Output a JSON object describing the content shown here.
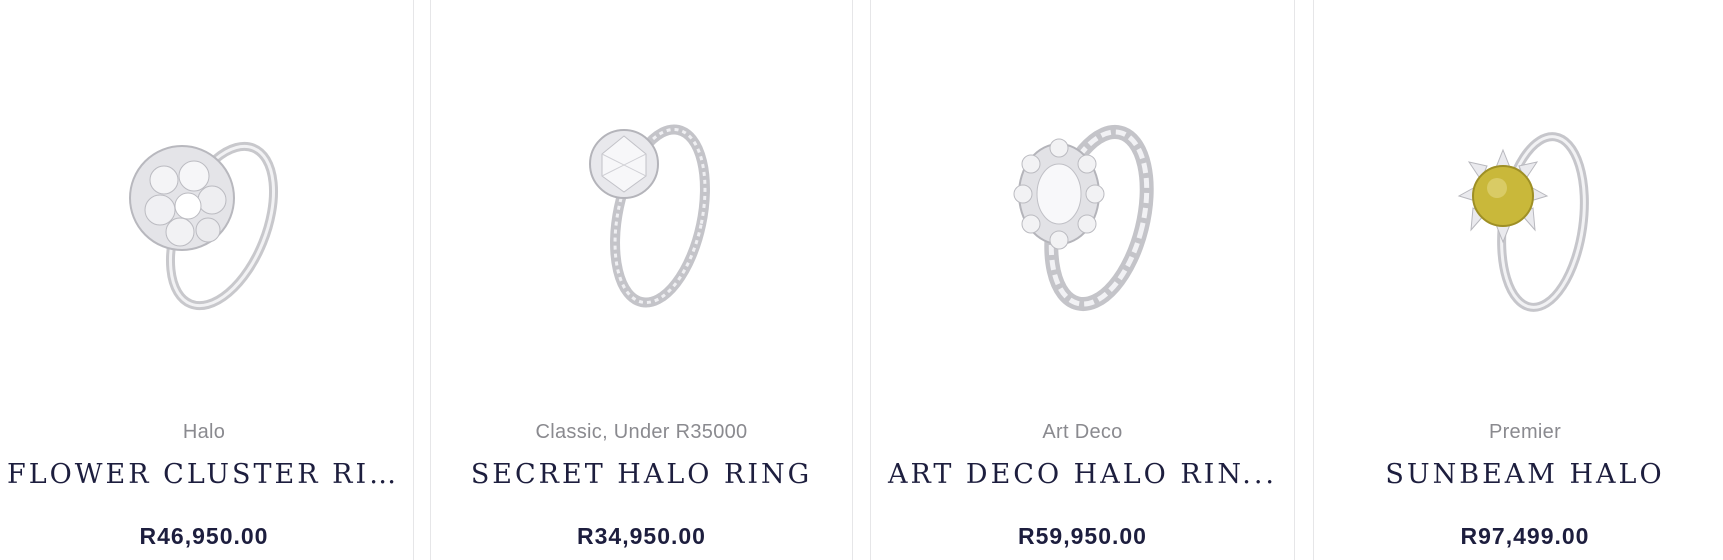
{
  "products": [
    {
      "category": "Halo",
      "title": "FLOWER CLUSTER RI...",
      "price": "R46,950.00",
      "image_icon": "ring-icon"
    },
    {
      "category": "Classic, Under R35000",
      "title": "SECRET HALO RING",
      "price": "R34,950.00",
      "image_icon": "ring-icon"
    },
    {
      "category": "Art Deco",
      "title": "ART DECO HALO RIN...",
      "price": "R59,950.00",
      "image_icon": "ring-icon"
    },
    {
      "category": "Premier",
      "title": "SUNBEAM HALO",
      "price": "R97,499.00",
      "image_icon": "ring-icon"
    }
  ],
  "colors": {
    "title": "#1d1e3e",
    "category": "#8a8a8f",
    "card_border": "#e6e6e8",
    "gem_yellow": "#c9b83a",
    "metal": "#c8c8cc"
  }
}
